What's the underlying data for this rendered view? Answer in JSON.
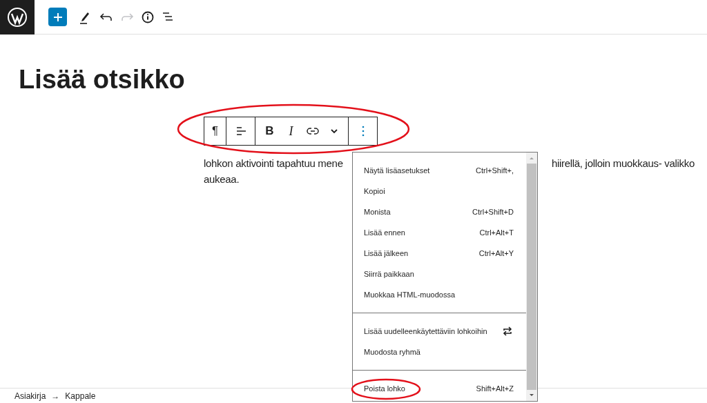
{
  "top_toolbar": {
    "buttons": [
      {
        "kind": "add",
        "disabled": false
      },
      {
        "kind": "edit",
        "disabled": false
      },
      {
        "kind": "undo",
        "disabled": false
      },
      {
        "kind": "redo",
        "disabled": true
      },
      {
        "kind": "info",
        "disabled": false
      },
      {
        "kind": "outline",
        "disabled": false
      }
    ]
  },
  "title": "Lisää otsikko",
  "block_toolbar": {
    "groups": [
      [
        {
          "kind": "text",
          "label": "¶"
        }
      ],
      [
        {
          "kind": "align"
        }
      ],
      [
        {
          "kind": "bold",
          "label": "B"
        },
        {
          "kind": "italic",
          "label": "I"
        },
        {
          "kind": "link"
        },
        {
          "kind": "chevron"
        }
      ],
      [
        {
          "kind": "more"
        }
      ]
    ]
  },
  "paragraph": {
    "line_1_start": "lohkon aktivointi tapahtuu mene",
    "line_1_end": "hiirellä, jolloin muokkaus- valikko",
    "line_2": "aukeaa."
  },
  "menu": {
    "sections": [
      [
        {
          "label": "Näytä lisäasetukset",
          "shortcut": "Ctrl+Shift+,"
        },
        {
          "label": "Kopioi"
        },
        {
          "label": "Monista",
          "shortcut": "Ctrl+Shift+D"
        },
        {
          "label": "Lisää ennen",
          "shortcut": "Ctrl+Alt+T"
        },
        {
          "label": "Lisää jälkeen",
          "shortcut": "Ctrl+Alt+Y"
        },
        {
          "label": "Siirrä paikkaan"
        },
        {
          "label": "Muokkaa HTML-muodossa"
        }
      ],
      [
        {
          "label": "Lisää uudelleenkäytettäviin lohkoihin",
          "kind": "reusable"
        },
        {
          "label": "Muodosta ryhmä"
        }
      ],
      [
        {
          "label": "Poista lohko",
          "shortcut": "Shift+Alt+Z"
        }
      ]
    ]
  },
  "breadcrumb": {
    "items": [
      "Asiakirja",
      "Kappale"
    ],
    "separator": "→"
  }
}
